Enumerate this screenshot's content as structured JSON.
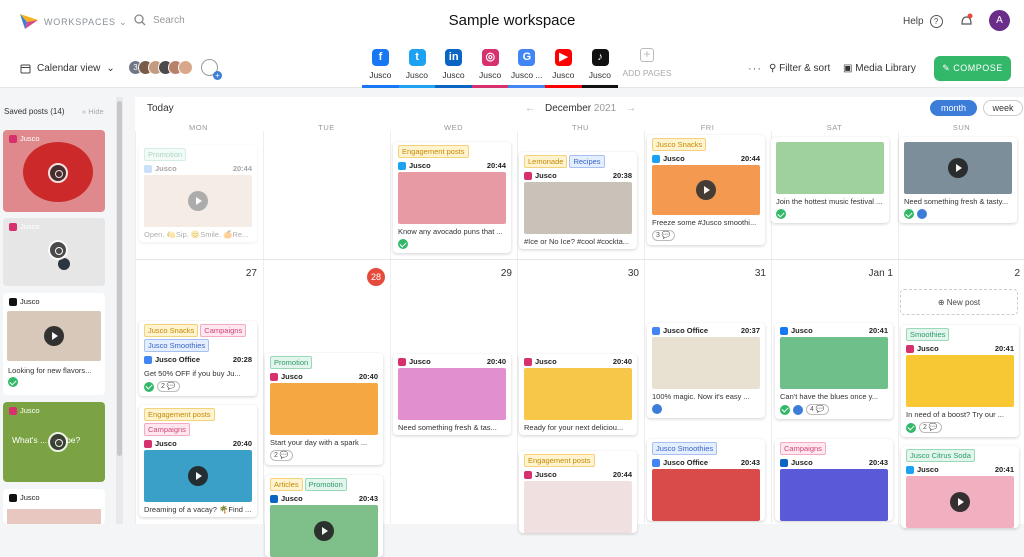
{
  "header": {
    "workspaces": "WORKSPACES",
    "search_placeholder": "Search",
    "title": "Sample workspace",
    "help": "Help"
  },
  "toolbar": {
    "calendar_view": "Calendar view",
    "avatar_count": "3",
    "add_pages": "ADD PAGES",
    "filter": "Filter & sort",
    "media": "Media Library",
    "compose": "COMPOSE",
    "pages": [
      {
        "label": "Jusco",
        "icon": "facebook-icon",
        "color": "#1877f2",
        "glyph": "f"
      },
      {
        "label": "Jusco",
        "icon": "twitter-icon",
        "color": "#1da1f2",
        "glyph": "t"
      },
      {
        "label": "Jusco",
        "icon": "linkedin-icon",
        "color": "#0a66c2",
        "glyph": "in"
      },
      {
        "label": "Jusco",
        "icon": "instagram-icon",
        "color": "#d6306e",
        "glyph": "◎"
      },
      {
        "label": "Jusco ...",
        "icon": "google-icon",
        "color": "#4285f4",
        "glyph": "G"
      },
      {
        "label": "Jusco",
        "icon": "youtube-icon",
        "color": "#ff0000",
        "glyph": "▶"
      },
      {
        "label": "Jusco",
        "icon": "tiktok-icon",
        "color": "#111111",
        "glyph": "♪"
      }
    ]
  },
  "sidebar": {
    "title": "Saved posts (14)",
    "hide": "« Hide",
    "posts": [
      {
        "name": "Jusco",
        "caption": ""
      },
      {
        "name": "Jusco",
        "caption": ""
      },
      {
        "name": "Jusco",
        "caption": "Looking for new flavors..."
      },
      {
        "name": "Jusco",
        "caption": "What's ... nna be?"
      },
      {
        "name": "Jusco",
        "caption": ""
      }
    ]
  },
  "calendar": {
    "today": "Today",
    "month": "December",
    "year": "2021",
    "view_month": "month",
    "view_week": "week",
    "weekdays": [
      "MON",
      "TUE",
      "WED",
      "THU",
      "FRI",
      "SAT",
      "SUN"
    ],
    "dates": [
      "27",
      "28",
      "29",
      "30",
      "31",
      "Jan 1",
      "2"
    ],
    "new_post": "New post",
    "cards": [
      {
        "tags": [
          "Promotion"
        ],
        "name": "Jusco",
        "time": "20:44",
        "caption": "Open. 🍋Sip. 😊Smile. 🍊Re..."
      },
      {
        "tags": [
          "Engagement posts"
        ],
        "name": "Jusco",
        "time": "20:44",
        "caption": "Know any avocado puns that ..."
      },
      {
        "tags": [
          "Lemonade",
          "Recipes"
        ],
        "name": "Jusco",
        "time": "20:38",
        "caption": "#Ice or No Ice? #cool #cockta..."
      },
      {
        "tags": [
          "Jusco Snacks"
        ],
        "name": "Jusco",
        "time": "20:44",
        "caption": "Freeze some #Jusco smoothi...",
        "comments": "3"
      },
      {
        "tags": [],
        "name": "",
        "time": "",
        "caption": "Join the hottest music festival ..."
      },
      {
        "tags": [],
        "name": "",
        "time": "",
        "caption": "Need something fresh & tasty..."
      },
      {
        "tags": [
          "Jusco Snacks",
          "Campaigns",
          "Jusco Smoothies"
        ],
        "name": "Jusco Office",
        "time": "20:28",
        "caption": "Get 50% OFF if you buy Ju...",
        "comments": "2"
      },
      {
        "tags": [
          "Engagement posts",
          "Campaigns"
        ],
        "name": "Jusco",
        "time": "20:40",
        "caption": "Dreaming of a vacay? 🌴Find ..."
      },
      {
        "tags": [
          "Promotion"
        ],
        "name": "Jusco",
        "time": "20:40",
        "caption": "Start your day with a spark ...",
        "comments": "2"
      },
      {
        "tags": [
          "Articles",
          "Promotion"
        ],
        "name": "Jusco",
        "time": "20:43",
        "caption": ""
      },
      {
        "tags": [],
        "name": "Jusco",
        "time": "20:40",
        "caption": "Need something fresh & tas..."
      },
      {
        "tags": [],
        "name": "Jusco",
        "time": "20:40",
        "caption": "Ready for your next deliciou..."
      },
      {
        "tags": [
          "Engagement posts"
        ],
        "name": "Jusco",
        "time": "20:44",
        "caption": ""
      },
      {
        "tags": [],
        "name": "Jusco Office",
        "time": "20:37",
        "caption": "100% magic. Now it's easy ..."
      },
      {
        "tags": [
          "Jusco Smoothies"
        ],
        "name": "Jusco Office",
        "time": "20:43",
        "caption": ""
      },
      {
        "tags": [],
        "name": "Jusco",
        "time": "20:41",
        "caption": "Can't have the blues once y...",
        "comments": "4"
      },
      {
        "tags": [
          "Campaigns"
        ],
        "name": "Jusco",
        "time": "20:43",
        "caption": ""
      },
      {
        "tags": [
          "Smoothies"
        ],
        "name": "Jusco",
        "time": "20:41",
        "caption": "In need of a boost? Try our ...",
        "comments": "2"
      },
      {
        "tags": [
          "Jusco Citrus Soda"
        ],
        "name": "Jusco",
        "time": "20:41",
        "caption": ""
      }
    ]
  }
}
